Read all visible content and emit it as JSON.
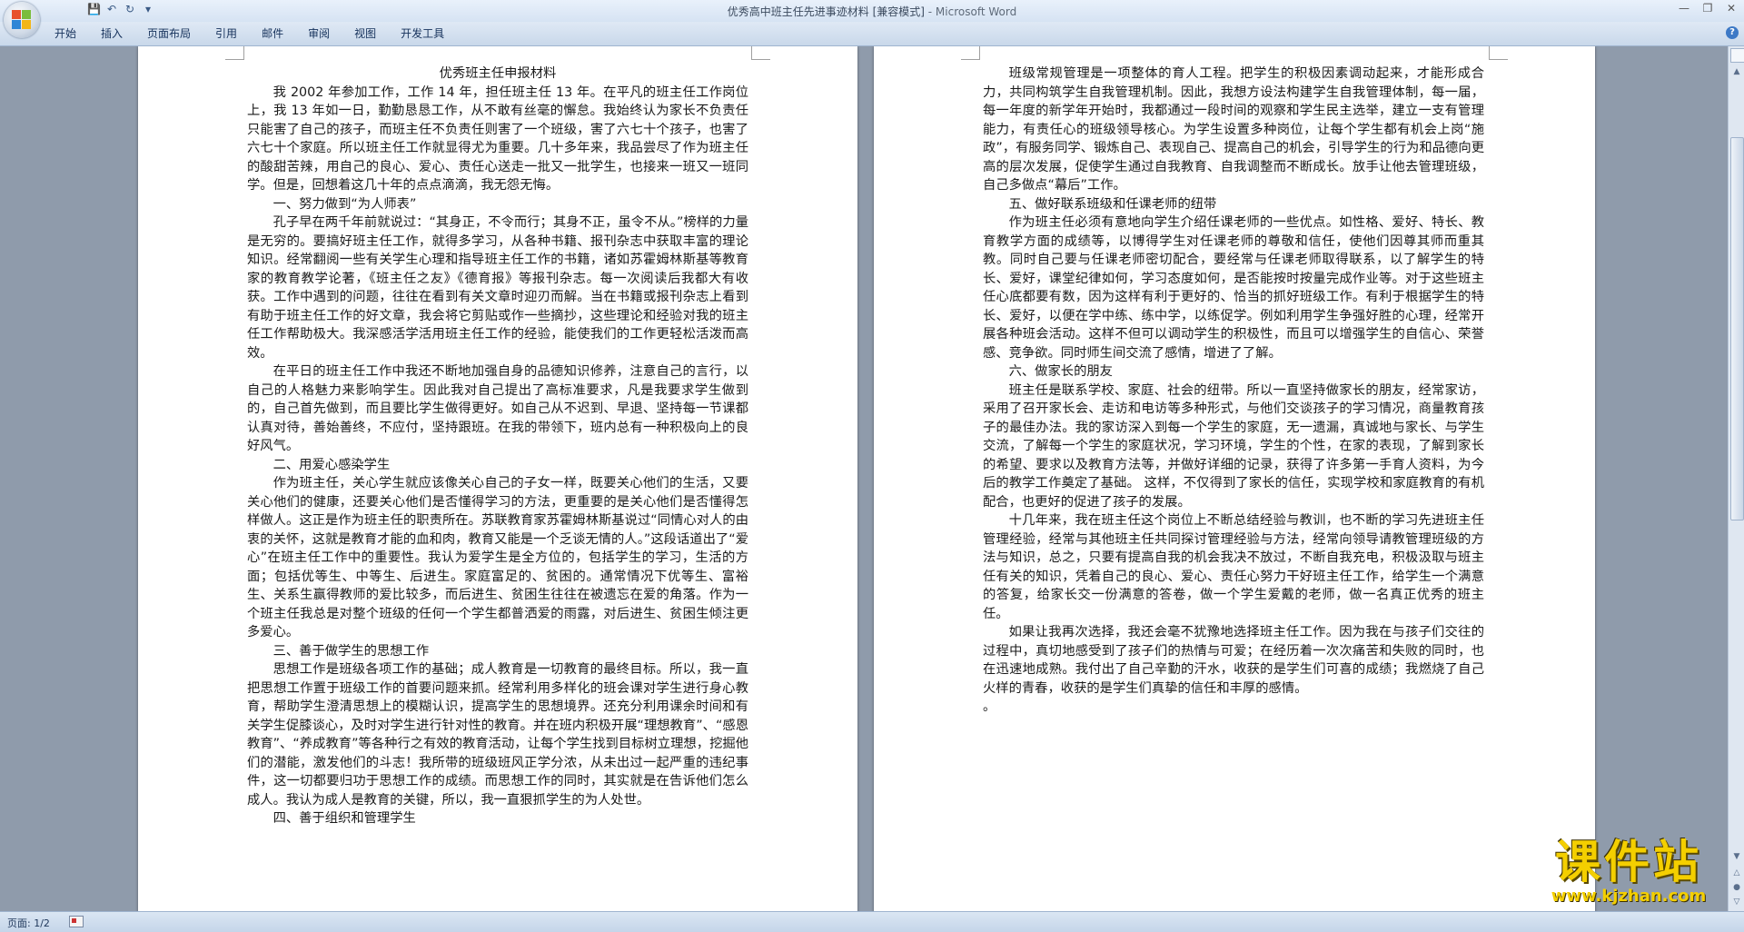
{
  "window": {
    "title": "优秀高中班主任先进事迹材料 [兼容模式]",
    "app_name": " - Microsoft Word"
  },
  "ribbon": {
    "tabs": [
      "开始",
      "插入",
      "页面布局",
      "引用",
      "邮件",
      "审阅",
      "视图",
      "开发工具"
    ]
  },
  "left_page": {
    "title": "优秀班主任申报材料",
    "paragraphs": [
      "我 2002 年参加工作，工作 14 年，担任班主任 13 年。在平凡的班主任工作岗位上，我 13 年如一日，勤勤恳恳工作，从不敢有丝毫的懈怠。我始终认为家长不负责任只能害了自己的孩子，而班主任不负责任则害了一个班级，害了六七十个孩子，也害了六七十个家庭。所以班主任工作就显得尤为重要。几十多年来，我品尝尽了作为班主任的酸甜苦辣，用自己的良心、爱心、责任心送走一批又一批学生，也接来一班又一班同学。但是，回想着这几十年的点点滴滴，我无怨无悔。",
      "一、努力做到“为人师表”",
      "孔子早在两千年前就说过：“其身正，不令而行；其身不正，虽令不从。”榜样的力量是无穷的。要搞好班主任工作，就得多学习，从各种书籍、报刊杂志中获取丰富的理论知识。经常翻阅一些有关学生心理和指导班主任工作的书籍，诸如苏霍姆林斯基等教育家的教育教学论著，《班主任之友》《德育报》等报刊杂志。每一次阅读后我都大有收获。工作中遇到的问题，往往在看到有关文章时迎刃而解。当在书籍或报刊杂志上看到有助于班主任工作的好文章，我会将它剪贴或作一些摘抄，这些理论和经验对我的班主任工作帮助极大。我深感活学活用班主任工作的经验，能使我们的工作更轻松活泼而高效。",
      "在平日的班主任工作中我还不断地加强自身的品德知识修养，注意自己的言行，以自己的人格魅力来影响学生。因此我对自己提出了高标准要求，凡是我要求学生做到的，自己首先做到，而且要比学生做得更好。如自己从不迟到、早退、坚持每一节课都认真对待，善始善终，不应付，坚持跟班。在我的带领下，班内总有一种积极向上的良好风气。",
      "二、用爱心感染学生",
      "作为班主任，关心学生就应该像关心自己的子女一样，既要关心他们的生活，又要关心他们的健康，还要关心他们是否懂得学习的方法，更重要的是关心他们是否懂得怎样做人。这正是作为班主任的职责所在。苏联教育家苏霍姆林斯基说过“同情心对人的由衷的关怀，这就是教育才能的血和肉，教育又能是一个乏谈无情的人。”这段话道出了“爱心”在班主任工作中的重要性。我认为爱学生是全方位的，包括学生的学习，生活的方面；包括优等生、中等生、后进生。家庭富足的、贫困的。通常情况下优等生、富裕生、关系生赢得教师的爱比较多，而后进生、贫困生往往在被遗忘在爱的角落。作为一个班主任我总是对整个班级的任何一个学生都普洒爱的雨露，对后进生、贫困生倾注更多爱心。",
      "三、善于做学生的思想工作",
      "思想工作是班级各项工作的基础；成人教育是一切教育的最终目标。所以，我一直把思想工作置于班级工作的首要问题来抓。经常利用多样化的班会课对学生进行身心教育，帮助学生澄清思想上的模糊认识，提高学生的思想境界。还充分利用课余时间和有关学生促膝谈心，及时对学生进行针对性的教育。并在班内积极开展“理想教育”、“感恩教育”、“养成教育”等各种行之有效的教育活动，让每个学生找到目标树立理想，挖掘他们的潜能，激发他们的斗志！我所带的班级班风正学分浓，从未出过一起严重的违纪事件，这一切都要归功于思想工作的成绩。而思想工作的同时，其实就是在告诉他们怎么成人。我认为成人是教育的关键，所以，我一直狠抓学生的为人处世。",
      "四、善于组织和管理学生"
    ]
  },
  "right_page": {
    "paragraphs": [
      "班级常规管理是一项整体的育人工程。把学生的积极因素调动起来，才能形成合力，共同构筑学生自我管理机制。因此，我想方设法构建学生自我管理体制，每一届，每一年度的新学年开始时，我都通过一段时间的观察和学生民主选举，建立一支有管理能力，有责任心的班级领导核心。为学生设置多种岗位，让每个学生都有机会上岗“施政”，有服务同学、锻炼自己、表现自己、提高自己的机会，引导学生的行为和品德向更高的层次发展，促使学生通过自我教育、自我调整而不断成长。放手让他去管理班级，自己多做点“幕后”工作。",
      "五、做好联系班级和任课老师的纽带",
      "作为班主任必须有意地向学生介绍任课老师的一些优点。如性格、爱好、特长、教育教学方面的成绩等，以博得学生对任课老师的尊敬和信任，使他们因尊其师而重其教。同时自己要与任课老师密切配合，要经常与任课老师取得联系，以了解学生的特长、爱好，课堂纪律如何，学习态度如何，是否能按时按量完成作业等。对于这些班主任心底都要有数，因为这样有利于更好的、恰当的抓好班级工作。有利于根据学生的特长、爱好，以便在学中练、练中学，以练促学。例如利用学生争强好胜的心理，经常开展各种班会活动。这样不但可以调动学生的积极性，而且可以增强学生的自信心、荣誉感、竞争欲。同时师生间交流了感情，增进了了解。",
      "六、做家长的朋友",
      "班主任是联系学校、家庭、社会的纽带。所以一直坚持做家长的朋友，经常家访，采用了召开家长会、走访和电访等多种形式，与他们交谈孩子的学习情况，商量教育孩子的最佳办法。我的家访深入到每一个学生的家庭，无一遗漏，真诚地与家长、与学生交流，了解每一个学生的家庭状况，学习环境，学生的个性，在家的表现，了解到家长的希望、要求以及教育方法等，并做好详细的记录，获得了许多第一手育人资料，为今后的教学工作奠定了基础。  这样，不仅得到了家长的信任，实现学校和家庭教育的有机配合，也更好的促进了孩子的发展。",
      "十几年来，我在班主任这个岗位上不断总结经验与教训，也不断的学习先进班主任管理经验，经常与其他班主任共同探讨管理经验与方法，经常向领导请教管理班级的方法与知识，总之，只要有提高自我的机会我决不放过，不断自我充电，积极汲取与班主任有关的知识，凭着自己的良心、爱心、责任心努力干好班主任工作，给学生一个满意的答复，给家长交一份满意的答卷，做一个学生爱戴的老师，做一名真正优秀的班主任。",
      "如果让我再次选择，我还会毫不犹豫地选择班主任工作。因为我在与孩子们交往的过程中，真切地感受到了孩子们的热情与可爱；在经历着一次次痛苦和失败的同时，也在迅速地成熟。我付出了自己辛勤的汗水，收获的是学生们可喜的成绩；我燃烧了自己火样的青春，收获的是学生们真挚的信任和丰厚的感情。",
      "。"
    ]
  },
  "status_bar": {
    "page_indicator": "页面: 1/2"
  },
  "watermark": {
    "title": "课件站",
    "url": "www.kjzhan.com"
  },
  "colors": {
    "brand_title": "#2a5fb0",
    "watermark": "#f4cf00"
  }
}
